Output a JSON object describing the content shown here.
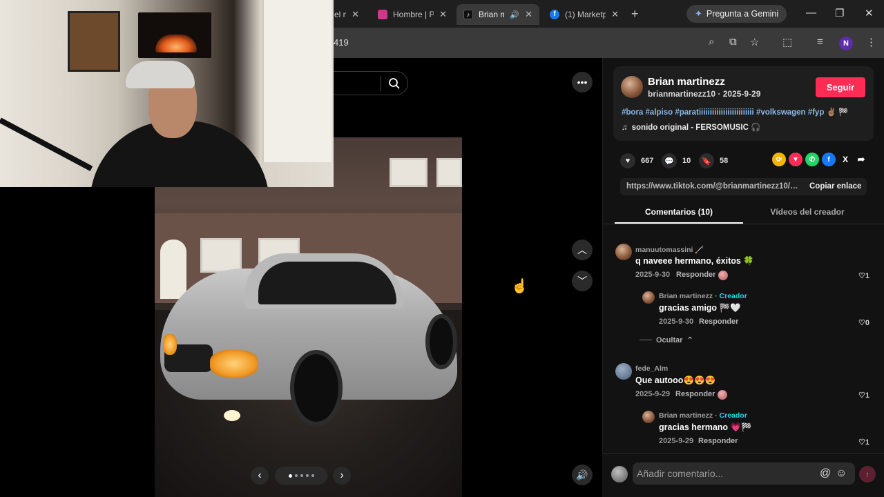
{
  "browser": {
    "tabs": [
      {
        "title": "el m",
        "color": "#6b6b6b"
      },
      {
        "title": "Hombre | P",
        "color": "#d0368a"
      },
      {
        "title": "Brian m",
        "color": "#111111",
        "active": true
      },
      {
        "title": "(1) Marketp",
        "color": "#1877f2"
      }
    ],
    "gemini_label": "Pregunta a Gemini",
    "url_fragment": "419",
    "profile_initial": "N",
    "icons": [
      "zoom-icon",
      "install-icon",
      "bookmark-star-icon",
      "extensions-icon",
      "media-icon",
      "kebab-menu-icon"
    ]
  },
  "viewer": {
    "pager_dots": 5,
    "active_dot": 0
  },
  "post": {
    "author_name": "Brian martinezz",
    "author_meta": "brianmartinezz10 · 2025-9-29",
    "follow_label": "Seguir",
    "hashtags": "#bora #alpiso #paratiiiiiiiiiiiiiiiiiiiiiiiii #volkswagen #fyp ✌🏽 🏁",
    "music": "sonido original - FERSOMUSIC 🎧",
    "likes": "667",
    "comments": "10",
    "saves": "58",
    "link": "https://www.tiktok.com/@brianmartinezz10/photo/...",
    "copy_label": "Copiar enlace",
    "share_colors": [
      "#f5b400",
      "#fe2c55",
      "#25d366",
      "#1877f2",
      "#111111",
      "#2c2c2c"
    ]
  },
  "tabs": {
    "comments": "Comentarios (10)",
    "videos": "Vídeos del creador"
  },
  "comments": [
    {
      "user": "manuutomassini 🦯",
      "text": "q naveee hermano, éxitos 🍀",
      "date": "2025-9-30",
      "reply": "Responder",
      "likes": "1"
    },
    {
      "user": "Brian martinezz",
      "creator": "Creador",
      "text": "gracias amigo 🏁🤍",
      "date": "2025-9-30",
      "reply": "Responder",
      "likes": "0"
    },
    {
      "user": "fede_Alm",
      "text": "Que autooo😍😍😍",
      "date": "2025-9-29",
      "reply": "Responder",
      "likes": "1"
    },
    {
      "user": "Brian martinezz",
      "creator": "Creador",
      "text": "gracias hermano 💗🏁",
      "date": "2025-9-29",
      "reply": "Responder",
      "likes": "1"
    }
  ],
  "hide_label": "Ocultar",
  "input": {
    "placeholder": "Añadir comentario..."
  }
}
